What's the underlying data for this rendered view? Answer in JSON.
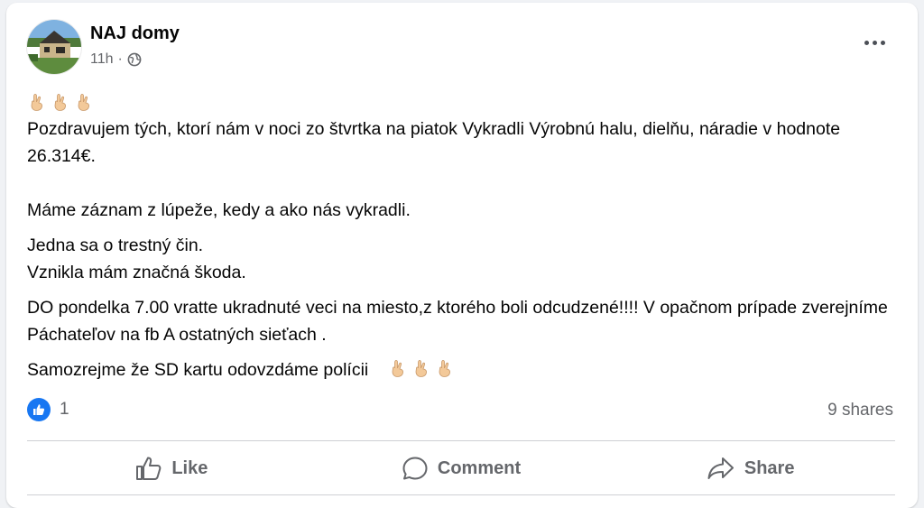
{
  "post": {
    "page_name": "NAJ domy",
    "time": "11h",
    "separator": "·",
    "privacy_icon": "globe-icon",
    "avatar_icon": "house-photo",
    "leading_emojis": [
      "finger-crossed-icon",
      "finger-crossed-icon",
      "finger-crossed-icon"
    ],
    "paragraphs": [
      "Pozdravujem tých, ktorí nám v noci zo štvrtka na piatok Vykradli Výrobnú halu,    dielňu, náradie v hodnote  26.314€.",
      "Máme záznam z lúpeže, kedy a ako nás vykradli.",
      "Jedna sa o trestný čin.",
      "Vznikla mám značná škoda.",
      "DO pondelka 7.00 vratte ukradnuté veci na miesto,z ktorého boli odcudzené!!!! V opačnom prípade zverejníme  Páchateľov na fb A ostatných sieťach .",
      "Samozrejme že SD kartu odovzdáme polícii"
    ],
    "trailing_emojis": [
      "finger-crossed-icon",
      "finger-crossed-icon",
      "finger-crossed-icon"
    ]
  },
  "stats": {
    "reaction_icon": "like-icon",
    "reaction_count": "1",
    "shares": "9 shares"
  },
  "actions": {
    "like_label": "Like",
    "comment_label": "Comment",
    "share_label": "Share"
  },
  "colors": {
    "accent": "#1877f2",
    "secondary_text": "#65676b",
    "divider": "#ced0d4"
  }
}
